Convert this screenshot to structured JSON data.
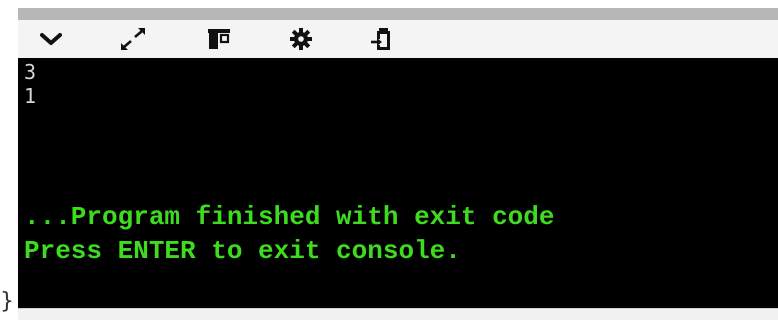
{
  "toolbar": {
    "buttons": [
      {
        "icon": "chevron-down-icon",
        "action": "collapse"
      },
      {
        "icon": "expand-arrows-icon",
        "action": "maximize"
      },
      {
        "icon": "panel-layout-icon",
        "action": "layout"
      },
      {
        "icon": "gear-icon",
        "action": "settings"
      },
      {
        "icon": "paste-clipboard-icon",
        "action": "paste"
      }
    ]
  },
  "console": {
    "output_lines": [
      "3",
      "1"
    ],
    "finish_line": "...Program finished with exit code",
    "prompt_line": "Press ENTER to exit console."
  },
  "editor_fragment": {
    "text": "}"
  },
  "colors": {
    "console_bg": "#000000",
    "output_text": "#d6d6d6",
    "status_text": "#3ddc1f",
    "toolbar_bg": "#f4f4f4"
  }
}
